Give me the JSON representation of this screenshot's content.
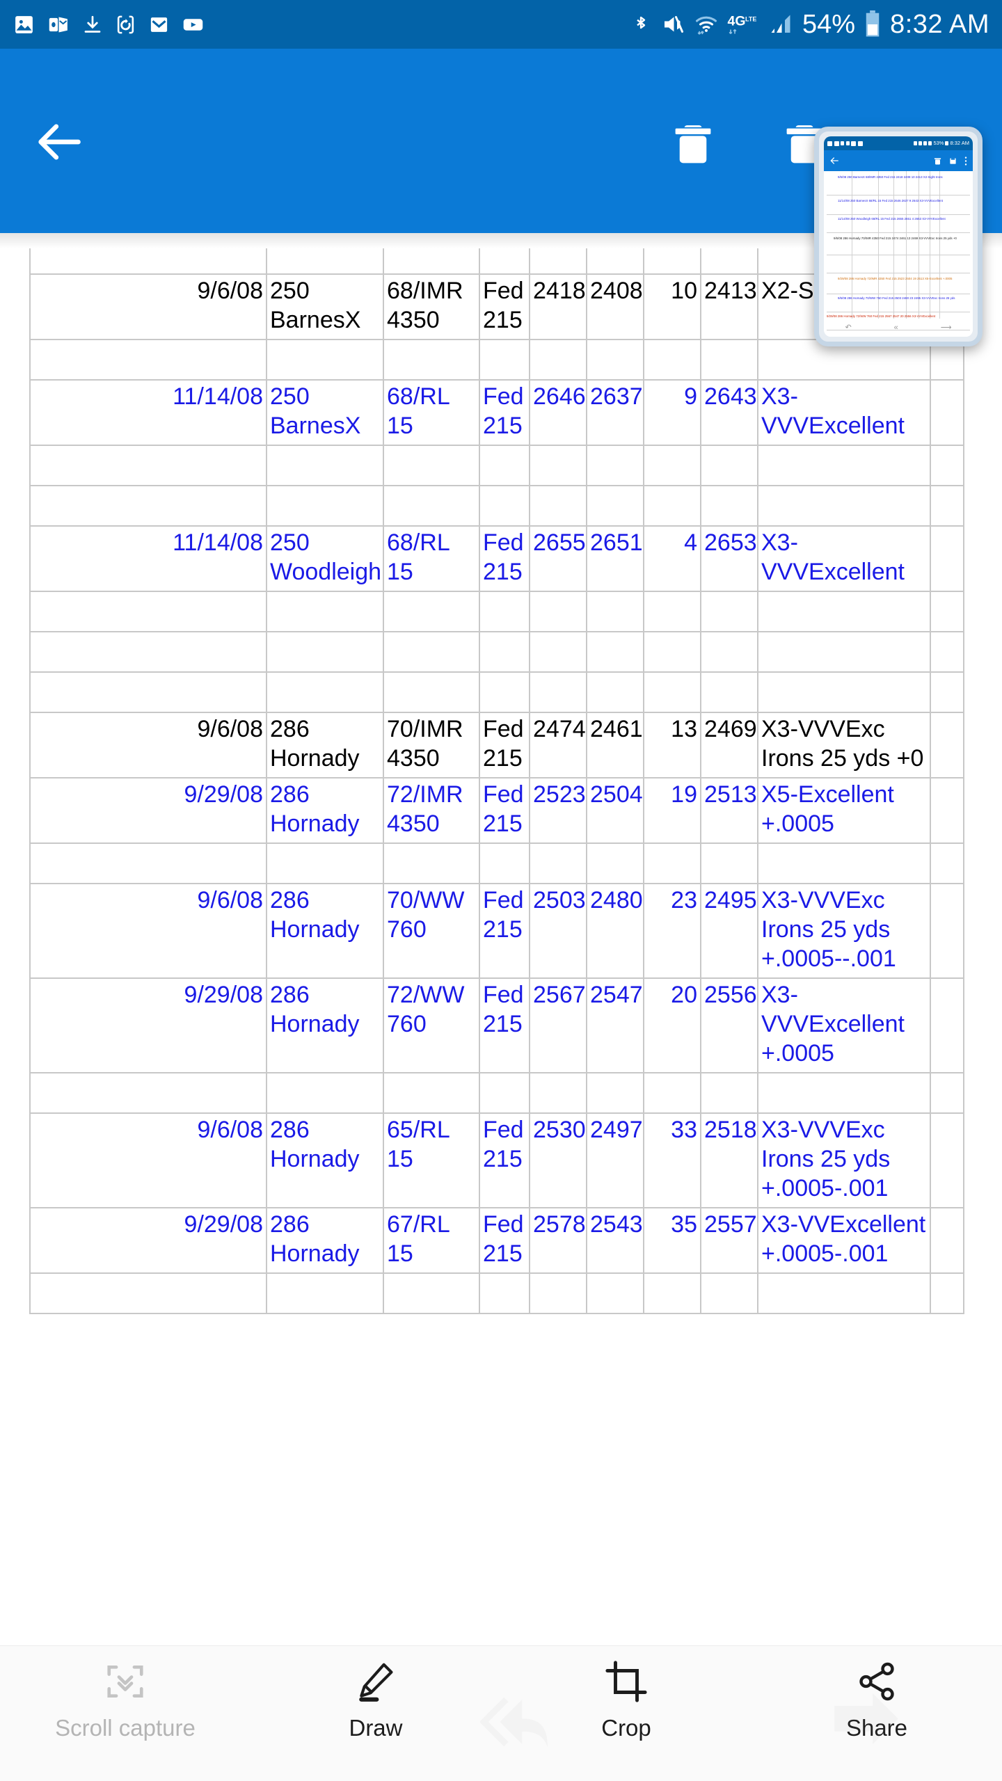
{
  "status_bar": {
    "time": "8:32 AM",
    "battery_percent": "54%",
    "network": "4G",
    "network_sub": "LTE",
    "left_icons": [
      "gallery-icon",
      "outlook-icon",
      "download-icon",
      "sync-icon",
      "mail-icon",
      "youtube-icon"
    ],
    "right_icons": [
      "bluetooth-icon",
      "mute-icon",
      "wifi-icon",
      "4glte-icon",
      "signal-icon",
      "battery-icon"
    ]
  },
  "toolbar": {
    "back_label": "Back",
    "delete_label": "Delete",
    "delete_secondary_label": "Delete"
  },
  "thumbnail": {
    "title": "Screenshot preview",
    "status_time": "8:32 AM",
    "status_battery": "53%",
    "nav": [
      "undo-arrow",
      "rewind-arrow",
      "forward-arrow"
    ],
    "toolbar_icons": [
      "back-icon",
      "trash-icon",
      "save-icon",
      "overflow-icon"
    ],
    "rows": [
      "9/6/08 250 BarnesX 68/IMR 4350 Fed 215 2418 2408 10 2413 X2-Sight Irons",
      "11/14/08 250 BarnesX 68/RL 15 Fed 215 2646 2637 9 2643 X3-VVVExcellent",
      "11/14/08 250 Woodleigh 68/RL 15 Fed 215 2655 2651 4 2653 X3-VVVExcellent",
      "9/6/08 286 Hornady 70/IMR 4350 Fed 215 2474 2461 13 2469 X3-VVVExc Irons 25 yds +0",
      "9/29/08 286 Hornady 72/IMR 4350 Fed 215 2523 2504 19 2513 X5-Excellent +.0005",
      "9/6/08 286 Hornady 70/WW 760 Fed 215 2503 2480 23 2495 X3-VVVExc Irons 25 yds",
      "9/29/08 286 Hornady 72/WW 760 Fed 215 2567 2547 20 2556 X3-VVVExcellent",
      "9/6/08 286 Hornady 65/RL 15 Fed 215 2530 2497 33 2518 X3-VVVExc Irons"
    ]
  },
  "sheet": {
    "rows": [
      {
        "type": "blank",
        "color": "black"
      },
      {
        "type": "data",
        "color": "black",
        "date": "9/6/08",
        "bullet": "250 BarnesX",
        "powder": "68/IMR 4350",
        "primer": "Fed 215",
        "v1": "2418",
        "v2": "2408",
        "es": "10",
        "avg": "2413",
        "note": "X2-Sight Irons"
      },
      {
        "type": "blank",
        "color": "black"
      },
      {
        "type": "data",
        "color": "blue",
        "date": "11/14/08",
        "bullet": "250 BarnesX",
        "powder": "68/RL 15",
        "primer": "Fed 215",
        "v1": "2646",
        "v2": "2637",
        "es": "9",
        "avg": "2643",
        "note": "X3-VVVExcellent"
      },
      {
        "type": "blank",
        "color": "blue"
      },
      {
        "type": "blank",
        "color": "blue"
      },
      {
        "type": "data",
        "color": "blue",
        "date": "11/14/08",
        "bullet": "250 Woodleigh",
        "powder": "68/RL 15",
        "primer": "Fed 215",
        "v1": "2655",
        "v2": "2651",
        "es": "4",
        "avg": "2653",
        "note": "X3-VVVExcellent"
      },
      {
        "type": "blank",
        "color": "blue"
      },
      {
        "type": "blank",
        "color": "blue"
      },
      {
        "type": "blank",
        "color": "blue"
      },
      {
        "type": "data",
        "color": "black",
        "date": "9/6/08",
        "bullet": "286 Hornady",
        "powder": "70/IMR 4350",
        "primer": "Fed 215",
        "v1": "2474",
        "v2": "2461",
        "es": "13",
        "avg": "2469",
        "note": "X3-VVVExc Irons 25 yds +0"
      },
      {
        "type": "data",
        "color": "blue",
        "date": "9/29/08",
        "bullet": "286 Hornady",
        "powder": "72/IMR 4350",
        "primer": "Fed 215",
        "v1": "2523",
        "v2": "2504",
        "es": "19",
        "avg": "2513",
        "note": "X5-Excellent +.0005"
      },
      {
        "type": "blank",
        "color": "blue"
      },
      {
        "type": "data",
        "color": "blue",
        "date": "9/6/08",
        "bullet": "286 Hornady",
        "powder": "70/WW 760",
        "primer": "Fed 215",
        "v1": "2503",
        "v2": "2480",
        "es": "23",
        "avg": "2495",
        "note": "X3-VVVExc Irons 25 yds +.0005--.001"
      },
      {
        "type": "data",
        "color": "blue",
        "date": "9/29/08",
        "bullet": "286 Hornady",
        "powder": "72/WW 760",
        "primer": "Fed 215",
        "v1": "2567",
        "v2": "2547",
        "es": "20",
        "avg": "2556",
        "note": "X3-VVVExcellent +.0005"
      },
      {
        "type": "blank",
        "color": "blue"
      },
      {
        "type": "data",
        "color": "blue",
        "date": "9/6/08",
        "bullet": "286 Hornady",
        "powder": "65/RL 15",
        "primer": "Fed 215",
        "v1": "2530",
        "v2": "2497",
        "es": "33",
        "avg": "2518",
        "note": "X3-VVVExc Irons 25 yds +.0005-.001"
      },
      {
        "type": "data",
        "color": "blue",
        "date": "9/29/08",
        "bullet": "286 Hornady",
        "powder": "67/RL 15",
        "primer": "Fed 215",
        "v1": "2578",
        "v2": "2543",
        "es": "35",
        "avg": "2557",
        "note": "X3-VVExcellent +.0005-.001"
      },
      {
        "type": "blank",
        "color": "blue"
      }
    ]
  },
  "bottom_bar": {
    "items": [
      {
        "label": "Scroll capture",
        "icon": "scroll-capture-icon",
        "enabled": false
      },
      {
        "label": "Draw",
        "icon": "draw-pen-icon",
        "enabled": true
      },
      {
        "label": "Crop",
        "icon": "crop-icon",
        "enabled": true
      },
      {
        "label": "Share",
        "icon": "share-nodes-icon",
        "enabled": true
      }
    ]
  },
  "colors": {
    "status_bar": "#0363a8",
    "toolbar": "#0b7ad6",
    "entry_blue": "#1a1ae6",
    "grid_line": "#c8c8c8"
  }
}
